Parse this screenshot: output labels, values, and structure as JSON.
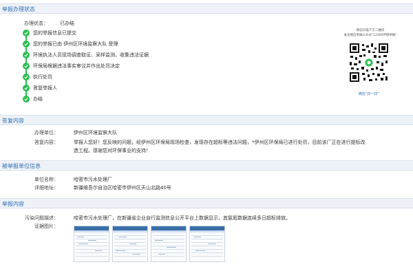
{
  "section1": {
    "title": "举报办理状态",
    "status_label": "办理状态：",
    "status_value": "已办结",
    "steps": [
      "您的举报信息已提交",
      "您的举报已由 伊州区环境监察大队 受理",
      "环境执法人员现场调查取证、采样监测、收集违法证据",
      "环保局根据违法事实审议并作出处罚决定",
      "执行处罚",
      "答复举报人",
      "办结"
    ],
    "qr_caption_top_1": "微信扫描下方二维码",
    "qr_caption_top_2": "关注微信举报公众号\"12369环保举报\"",
    "qr_caption_bottom": "微信“扫一扫”"
  },
  "section2": {
    "title": "答复内容",
    "unit_label": "办理单位：",
    "unit_value": "伊州区环境监察大队",
    "reply_label": "答复内容：",
    "reply_line1": "举报人您好！您反映的问题，经伊州区环保局现场检查，发现存在超标等违法问题，*伊州区环保局已进行处罚，目前该厂正在进行提标改",
    "reply_line2": "造工程。感谢您对环保事业的支持！"
  },
  "section3": {
    "title": "被举报单位信息",
    "name_label": "单位名称：",
    "name_value": "哈密市污水处理厂",
    "addr_label": "详细地址：",
    "addr_value": "新疆维吾尔自治区哈密市伊州区天山北路40号"
  },
  "section4": {
    "title": "举报内容",
    "desc_label": "污染问题描述：",
    "desc_value": "哈密市污水处理厂，在新疆省企业自行监测信息公开平台上数据显示，其氨氮数据连续多日超标排放。",
    "evidence_label": "证据图片："
  },
  "colors": {
    "accent": "#2f6fb3",
    "step_green": "#2dbd52",
    "header_bg": "#eef2f8"
  }
}
